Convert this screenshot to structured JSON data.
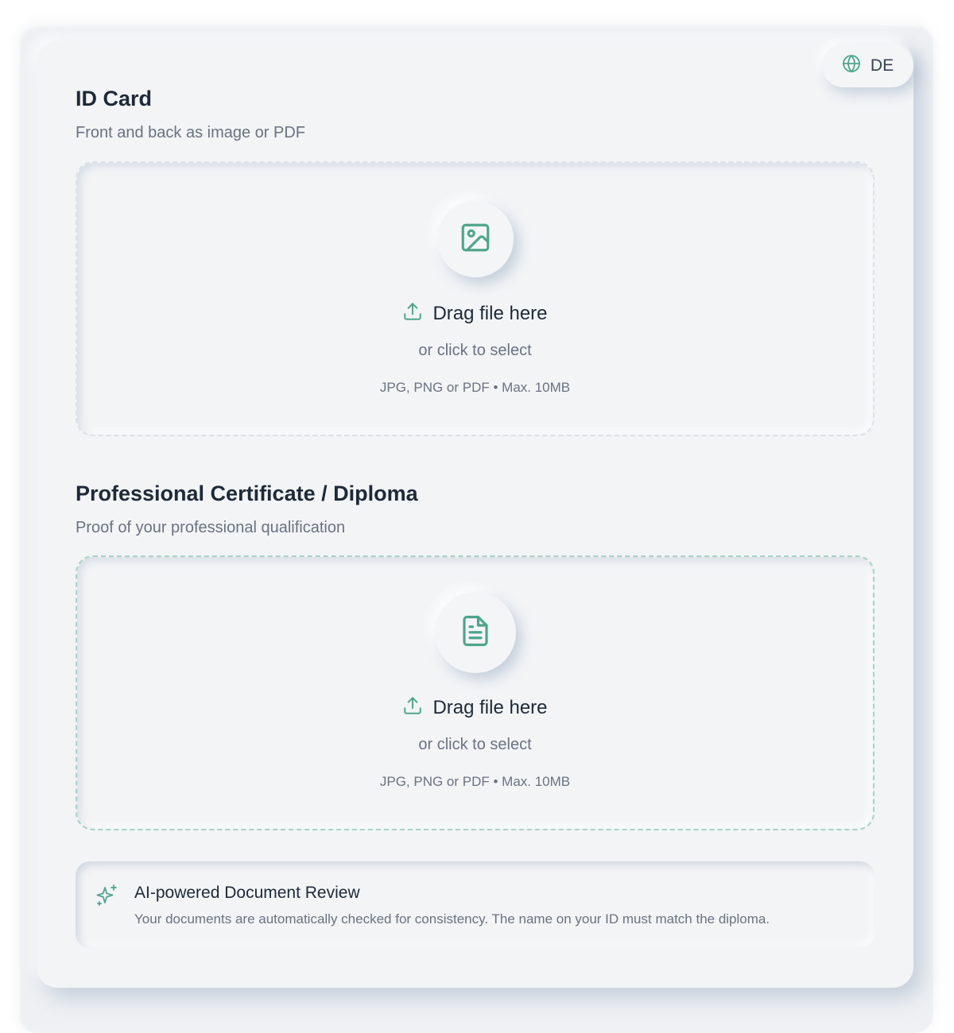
{
  "language": {
    "label": "DE",
    "icon": "globe-icon"
  },
  "sections": [
    {
      "title": "ID Card",
      "subtitle": "Front and back as image or PDF",
      "icon": "image-icon",
      "drop_label": "Drag file here",
      "or_label": "or click to select",
      "formats": "JPG, PNG or PDF • Max. 10MB"
    },
    {
      "title": "Professional Certificate / Diploma",
      "subtitle": "Proof of your professional qualification",
      "icon": "document-icon",
      "drop_label": "Drag file here",
      "or_label": "or click to select",
      "formats": "JPG, PNG or PDF • Max. 10MB"
    }
  ],
  "ai_review": {
    "title": "AI-powered Document Review",
    "text": "Your documents are automatically checked for consistency. The name on your ID must match the diploma.",
    "icon": "sparkles-icon"
  },
  "colors": {
    "accent": "#4fa58a",
    "background": "#f2f4f6",
    "text_primary": "#1f2937",
    "text_secondary": "#6b7280"
  }
}
